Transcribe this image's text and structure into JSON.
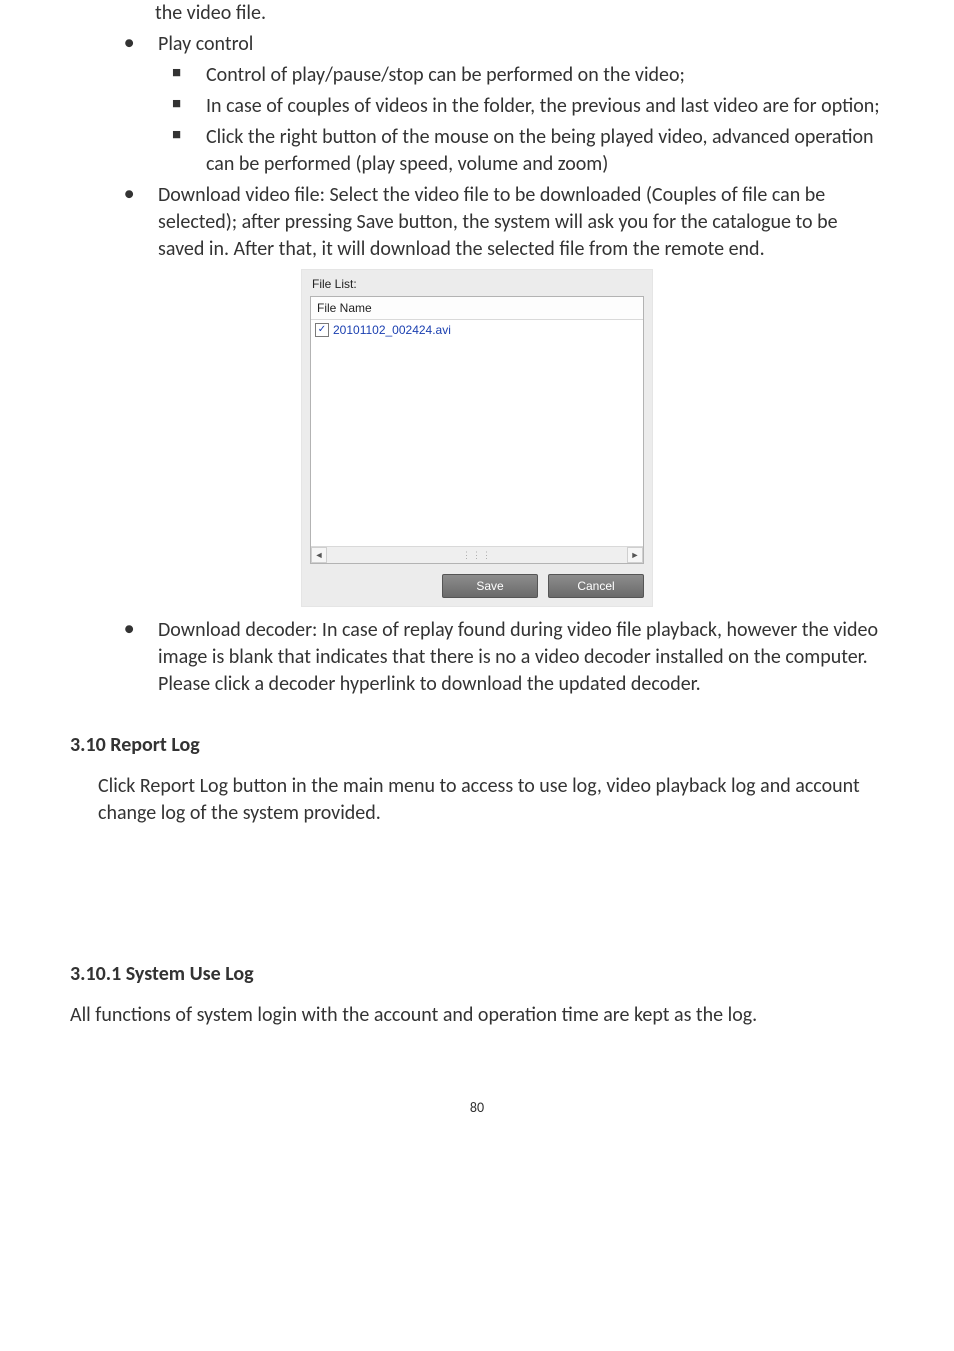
{
  "top_fragment": "the video file.",
  "list_disc": [
    "Play control",
    "Download video file: Select the video file to be downloaded (Couples of file can be selected); after pressing Save button, the system will ask you for the catalogue to be saved in. After that, it will download the selected file from the remote end.",
    "Download decoder: In case of replay found during video file playback, however the video image is blank that indicates that there is no a video decoder installed on the computer. Please click a decoder hyperlink to download the updated decoder."
  ],
  "list_sq": [
    "Control of play/pause/stop can be performed on the video;",
    "In case of couples of videos in the folder, the previous and last video are for option;",
    "Click the right button of the mouse on the being played video, advanced operation can be performed (play speed, volume and zoom)"
  ],
  "dialog": {
    "title": "File List:",
    "col_header": "File Name",
    "file_name": "20101102_002424.avi",
    "save": "Save",
    "cancel": "Cancel",
    "checked": "✓"
  },
  "sec_310": "3.10 Report Log",
  "para_310": "Click Report Log button in the main menu to access to use log, video playback log and account change log of the system provided.",
  "sec_3101": "3.10.1 System Use Log",
  "para_3101": "All functions of system login with the account and operation time are kept as the log.",
  "page_number": "80"
}
